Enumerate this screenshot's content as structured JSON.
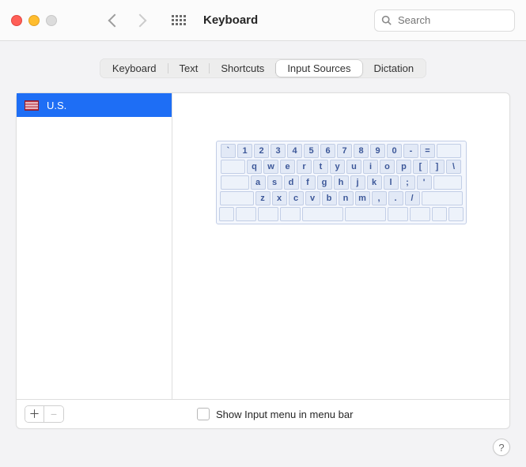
{
  "window": {
    "title": "Keyboard"
  },
  "search": {
    "placeholder": "Search"
  },
  "tabs": [
    {
      "label": "Keyboard",
      "selected": false
    },
    {
      "label": "Text",
      "selected": false
    },
    {
      "label": "Shortcuts",
      "selected": false
    },
    {
      "label": "Input Sources",
      "selected": true
    },
    {
      "label": "Dictation",
      "selected": false
    }
  ],
  "sources": [
    {
      "label": "U.S.",
      "flag": "us",
      "selected": true
    }
  ],
  "keyboard_rows": [
    [
      {
        "l": "`"
      },
      {
        "l": "1"
      },
      {
        "l": "2"
      },
      {
        "l": "3"
      },
      {
        "l": "4"
      },
      {
        "l": "5"
      },
      {
        "l": "6"
      },
      {
        "l": "7"
      },
      {
        "l": "8"
      },
      {
        "l": "9"
      },
      {
        "l": "0"
      },
      {
        "l": "-"
      },
      {
        "l": "=",
        "w": "1"
      },
      {
        "l": "",
        "w": "15",
        "blank": true
      }
    ],
    [
      {
        "l": "",
        "w": "15",
        "blank": true
      },
      {
        "l": "q"
      },
      {
        "l": "w"
      },
      {
        "l": "e"
      },
      {
        "l": "r"
      },
      {
        "l": "t"
      },
      {
        "l": "y"
      },
      {
        "l": "u"
      },
      {
        "l": "i"
      },
      {
        "l": "o"
      },
      {
        "l": "p"
      },
      {
        "l": "["
      },
      {
        "l": "]"
      },
      {
        "l": "\\"
      }
    ],
    [
      {
        "l": "",
        "w": "175",
        "blank": true
      },
      {
        "l": "a"
      },
      {
        "l": "s"
      },
      {
        "l": "d"
      },
      {
        "l": "f"
      },
      {
        "l": "g"
      },
      {
        "l": "h"
      },
      {
        "l": "j"
      },
      {
        "l": "k"
      },
      {
        "l": "l"
      },
      {
        "l": ";"
      },
      {
        "l": "'"
      },
      {
        "l": "",
        "w": "175",
        "blank": true
      }
    ],
    [
      {
        "l": "",
        "w": "2",
        "blank": true
      },
      {
        "l": "z"
      },
      {
        "l": "x"
      },
      {
        "l": "c"
      },
      {
        "l": "v"
      },
      {
        "l": "b"
      },
      {
        "l": "n"
      },
      {
        "l": "m"
      },
      {
        "l": ","
      },
      {
        "l": "."
      },
      {
        "l": "/"
      },
      {
        "l": "",
        "w": "25",
        "blank": true
      }
    ],
    [
      {
        "l": "",
        "blank": true
      },
      {
        "l": "",
        "w": "125",
        "blank": true
      },
      {
        "l": "",
        "w": "125",
        "blank": true
      },
      {
        "l": "",
        "w": "125",
        "blank": true
      },
      {
        "l": "",
        "w": "25",
        "blank": true,
        "space": true
      },
      {
        "l": "",
        "w": "25",
        "blank": true,
        "space": true
      },
      {
        "l": "",
        "w": "125",
        "blank": true
      },
      {
        "l": "",
        "w": "125",
        "blank": true
      },
      {
        "l": "",
        "blank": true
      },
      {
        "l": "",
        "blank": true
      }
    ]
  ],
  "show_menu_label": "Show Input menu in menu bar",
  "show_menu_checked": false,
  "help_label": "?"
}
